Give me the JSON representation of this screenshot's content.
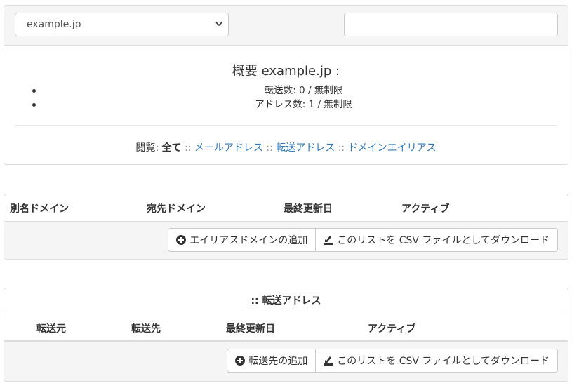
{
  "domain_select": {
    "value": "example.jp"
  },
  "search": {
    "placeholder": ""
  },
  "overview": {
    "title": "概要 example.jp :",
    "stats": [
      "転送数: 0 / 無制限",
      "アドレス数: 1 / 無制限"
    ]
  },
  "browse": {
    "label": "閲覧:",
    "current": "全て",
    "separator": "::",
    "links": [
      "メールアドレス",
      "転送アドレス",
      "ドメインエイリアス"
    ]
  },
  "alias_domains": {
    "columns": [
      "別名ドメイン",
      "宛先ドメイン",
      "最終更新日",
      "アクティブ"
    ],
    "add_button": "エイリアスドメインの追加",
    "download_button": "このリストを CSV ファイルとしてダウンロード"
  },
  "forwarding": {
    "title": ":: 転送アドレス",
    "columns": [
      "転送元",
      "転送先",
      "最終更新日",
      "アクティブ"
    ],
    "add_button": "転送先の追加",
    "download_button": "このリストを CSV ファイルとしてダウンロード"
  },
  "colors": {
    "link": "#337ab7",
    "panel_bg": "#f5f5f5",
    "border": "#dddddd"
  }
}
